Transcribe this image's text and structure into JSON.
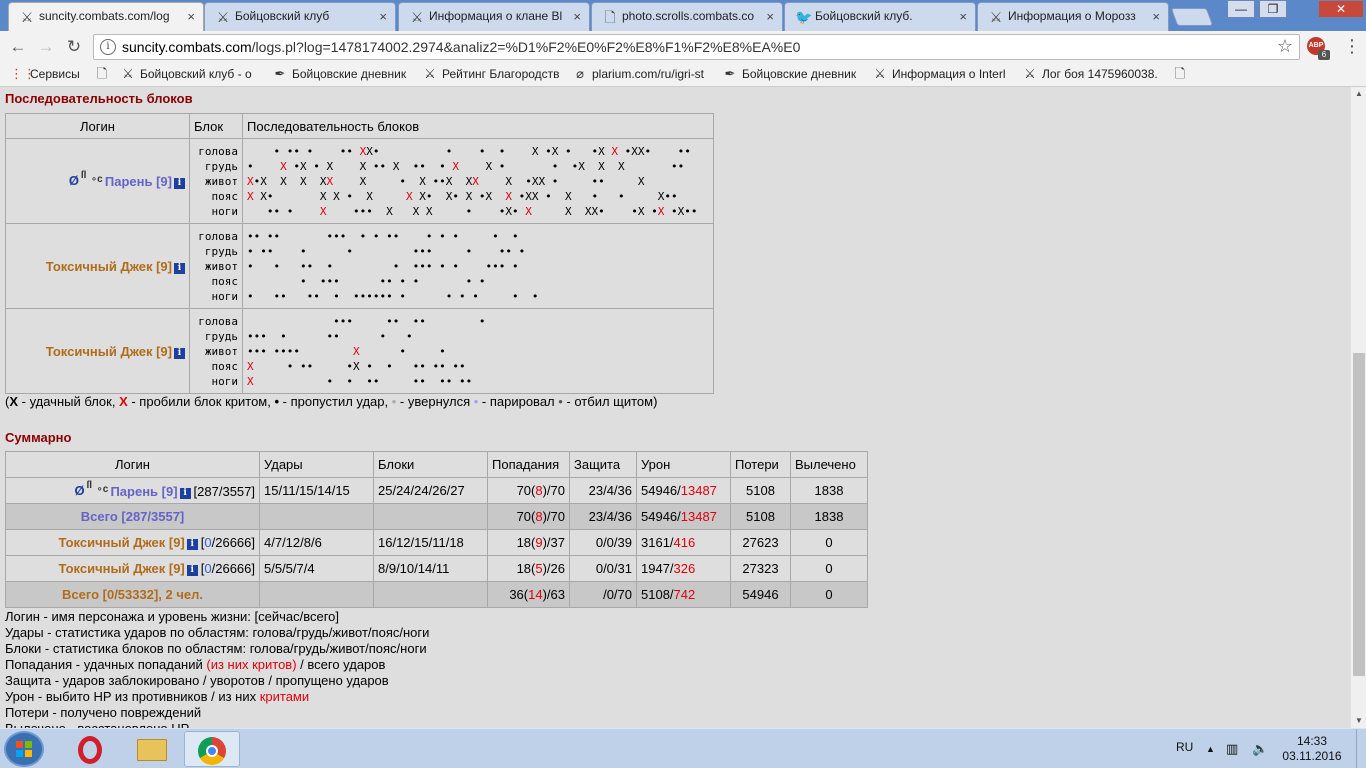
{
  "tabs": [
    {
      "title": "suncity.combats.com/log",
      "icon": "crossed-swords-icon",
      "active": true
    },
    {
      "title": "Бойцовский клуб",
      "icon": "crossed-swords-icon"
    },
    {
      "title": "Информация о клане Bl",
      "icon": "crossed-swords-icon"
    },
    {
      "title": "photo.scrolls.combats.co",
      "icon": "page-icon"
    },
    {
      "title": "Бойцовский клуб.",
      "icon": "bird-icon"
    },
    {
      "title": "Информация о Морозз",
      "icon": "crossed-swords-icon"
    }
  ],
  "tab_close_glyph": "×",
  "window_controls": {
    "minimize": "—",
    "maximize": "❐",
    "close": "✕"
  },
  "url": {
    "host": "suncity.combats.com",
    "path": "/logs.pl?log=1478174002.2974&analiz2=%D1%F2%E0%F2%E8%F1%F2%E8%EA%E0"
  },
  "abp_label": "ABP",
  "abp_count": "6",
  "bookmarks": [
    {
      "label": "Сервисы",
      "icon": "apps-grid-icon"
    },
    {
      "label": "",
      "icon": "page-icon"
    },
    {
      "label": "Бойцовский клуб - о",
      "icon": "crossed-swords-icon"
    },
    {
      "label": "Бойцовские дневник",
      "icon": "quill-icon"
    },
    {
      "label": "Рейтинг Благородств",
      "icon": "crossed-swords-icon"
    },
    {
      "label": "plarium.com/ru/igri-st",
      "icon": "plarium-icon"
    },
    {
      "label": "Бойцовские дневник",
      "icon": "quill-icon"
    },
    {
      "label": "Информация о Interl",
      "icon": "crossed-swords-icon"
    },
    {
      "label": "Лог боя 1475960038.",
      "icon": "crossed-swords-icon"
    },
    {
      "label": "",
      "icon": "page-icon"
    }
  ],
  "blocks": {
    "title": "Последовательность блоков",
    "headers": {
      "login": "Логин",
      "block": "Блок",
      "sequence": "Последовательность блоков"
    },
    "zones": [
      "голова",
      "грудь",
      "живот",
      "пояс",
      "ноги"
    ],
    "players": [
      {
        "name": "Парень [9]",
        "color": "blue",
        "align": true,
        "rows": [
          "    • •• •    •• XX•          •    •  •    X •X •   •X X •XX•    ••",
          "•    X •X • X    X •• X  ••  • X    X •       •  •X  X  X       ••",
          "X•X  X  X  XX    X     •  X ••X  XX    X  •XX •     ••     X",
          "X X•       X X •  X     X X•  X• X •X  X •XX •  X   •   •     X••",
          "   •• •    X    •••  X   X X     •    •X• X     X  XX•    •X •X •X••"
        ]
      },
      {
        "name": "Токсичный Джек [9]",
        "color": "brown",
        "align": false,
        "rows": [
          "•• ••       •••  • • ••    • • •     •  •",
          "• ••    •      •         •••     •    •• •",
          "•   •   ••  •         •  ••• • •    ••• •",
          "        •  •••      •• • •       • •",
          "•   ••   ••  •  •••••• •      • • •     •  •"
        ]
      },
      {
        "name": "Токсичный Джек [9]",
        "color": "brown",
        "align": false,
        "rows": [
          "             •••     ••  ••        •",
          "•••  •      ••      •   •",
          "••• ••••        X      •     •",
          "X     • ••     •X •  •   •• •• ••",
          "X           •  •  ••     ••  •• ••"
        ]
      }
    ],
    "legend": [
      {
        "sym": "X",
        "cls": "",
        "bold": true,
        "text": " - удачный блок, "
      },
      {
        "sym": "X",
        "cls": "red",
        "bold": true,
        "text": " - пробили блок критом, "
      },
      {
        "sym": "•",
        "cls": "",
        "bold": true,
        "text": " - пропустил удар, "
      },
      {
        "sym": "•",
        "cls": "grey",
        "bold": false,
        "text": " - увернулся "
      },
      {
        "sym": "•",
        "cls": "lilac",
        "bold": false,
        "text": " - парировал "
      },
      {
        "sym": "•",
        "cls": "dark",
        "bold": false,
        "text": " - отбил щитом)"
      }
    ]
  },
  "summary": {
    "title": "Суммарно",
    "headers": [
      "Логин",
      "Удары",
      "Блоки",
      "Попадания",
      "Защита",
      "Урон",
      "Потери",
      "Вылечено"
    ],
    "rows": [
      {
        "type": "player",
        "name": "Парень [9]",
        "color": "blue",
        "align": true,
        "hp": "[287/3557]",
        "hp_cur": "",
        "hp_rest": "",
        "hits": "15/11/15/14/15",
        "blocks": "25/24/24/26/27",
        "hit_a": "70(",
        "hit_b": "8",
        "hit_c": ")/70",
        "defense": "23/4/36",
        "dmg_a": "54946/",
        "dmg_b": "13487",
        "losses": "5108",
        "healed": "1838"
      },
      {
        "type": "total",
        "name": "Всего [287/3557]",
        "color": "blue",
        "hit_a": "70(",
        "hit_b": "8",
        "hit_c": ")/70",
        "defense": "23/4/36",
        "dmg_a": "54946/",
        "dmg_b": "13487",
        "losses": "5108",
        "healed": "1838"
      },
      {
        "type": "player",
        "name": "Токсичный Джек [9]",
        "color": "brown",
        "align": false,
        "hp": "",
        "hp_cur": "0",
        "hp_rest": "/26666]",
        "hits": "4/7/12/8/6",
        "blocks": "16/12/15/11/18",
        "hit_a": "18(",
        "hit_b": "9",
        "hit_c": ")/37",
        "defense": "0/0/39",
        "dmg_a": "3161/",
        "dmg_b": "416",
        "losses": "27623",
        "healed": "0"
      },
      {
        "type": "player",
        "name": "Токсичный Джек [9]",
        "color": "brown",
        "align": false,
        "hp": "",
        "hp_cur": "0",
        "hp_rest": "/26666]",
        "hits": "5/5/5/7/4",
        "blocks": "8/9/10/14/11",
        "hit_a": "18(",
        "hit_b": "5",
        "hit_c": ")/26",
        "defense": "0/0/31",
        "dmg_a": "1947/",
        "dmg_b": "326",
        "losses": "27323",
        "healed": "0"
      },
      {
        "type": "total",
        "name": "Всего [0/53332], 2 чел.",
        "color": "brown",
        "hit_a": "36(",
        "hit_b": "14",
        "hit_c": ")/63",
        "defense": "/0/70",
        "dmg_a": "5108/",
        "dmg_b": "742",
        "losses": "54946",
        "healed": "0"
      }
    ]
  },
  "notes": [
    {
      "a": "Логин - имя персонажа и уровень жизни: [сейчас/всего]"
    },
    {
      "a": "Удары - статистика ударов по областям: голова/грудь/живот/пояс/ноги"
    },
    {
      "a": "Блоки - статистика блоков по областям: голова/грудь/живот/пояс/ноги"
    },
    {
      "a": "Попадания - удачных попаданий ",
      "r": "(из них критов)",
      "b": " / всего ударов"
    },
    {
      "a": "Защита - ударов заблокировано / уворотов / пропущено ударов"
    },
    {
      "a": "Урон - выбито HP из противников / из них ",
      "r": "критами"
    },
    {
      "a": "Потери - получено повреждений"
    },
    {
      "a": "Вылечено - восстановлено HP"
    }
  ],
  "taskbar": {
    "lang": "RU",
    "time": "14:33",
    "date": "03.11.2016",
    "apps": [
      "opera-icon",
      "explorer-folder-icon",
      "chrome-icon"
    ]
  }
}
